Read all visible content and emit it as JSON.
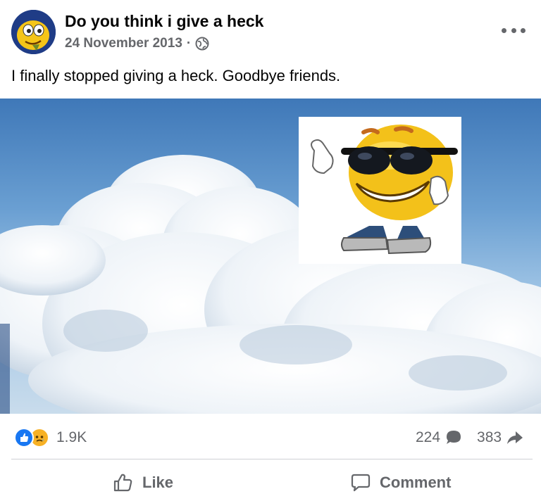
{
  "post": {
    "author": "Do you think i give a heck",
    "date": "24 November 2013",
    "separator": "·",
    "audience_icon": "globe-icon",
    "caption": "I finally stopped giving a heck. Goodbye friends."
  },
  "image": {
    "background": "sky with clouds",
    "sticker": "sunglasses-smiley-thumbs-up"
  },
  "stats": {
    "reactions_count": "1.9K",
    "reaction_types": [
      "like",
      "sad"
    ],
    "comments_count": "224",
    "shares_count": "383"
  },
  "actions": {
    "like_label": "Like",
    "comment_label": "Comment"
  },
  "colors": {
    "brand_blue": "#1877f2",
    "secondary_text": "#65676b",
    "primary_text": "#050505",
    "divider": "#ced0d4"
  }
}
